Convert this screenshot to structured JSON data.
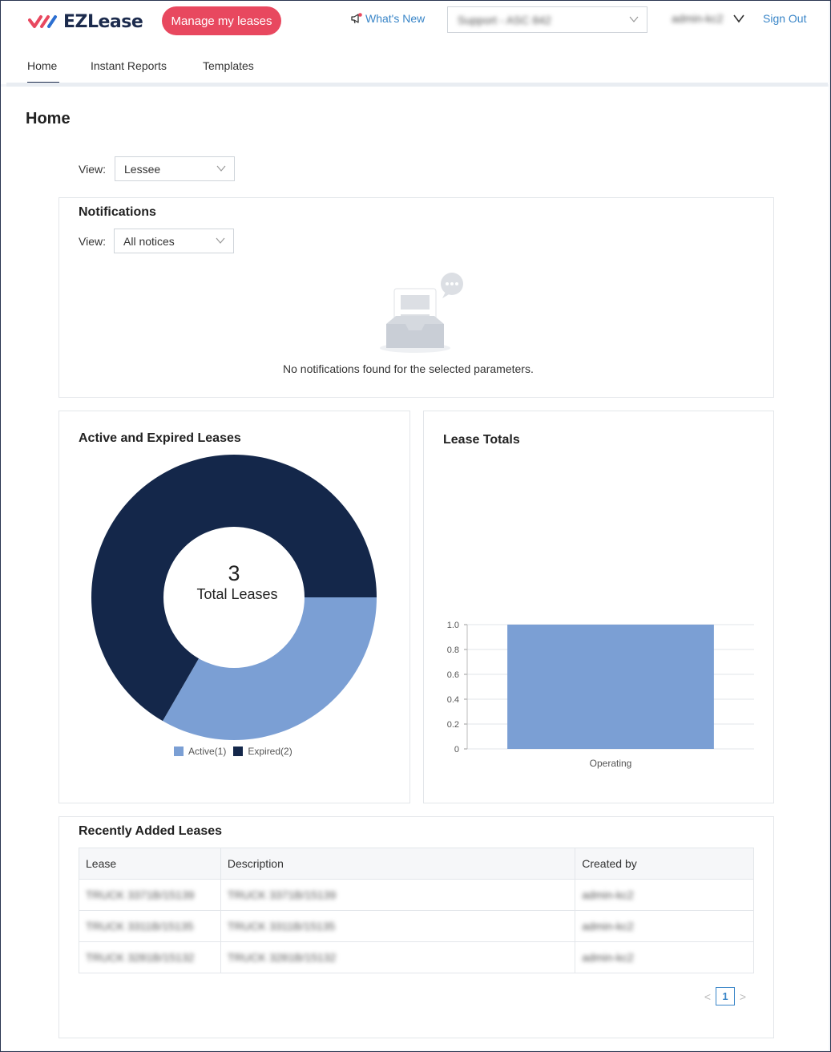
{
  "header": {
    "logo_text": "EZLease",
    "manage_button": "Manage my leases",
    "whats_new": "What's New",
    "support_select_value": "Support - ASC 842",
    "user_name": "admin-kc2",
    "sign_out": "Sign Out"
  },
  "tabs": [
    {
      "label": "Home",
      "active": true
    },
    {
      "label": "Instant Reports"
    },
    {
      "label": "Templates"
    }
  ],
  "page_title": "Home",
  "view_filter": {
    "label": "View:",
    "value": "Lessee"
  },
  "notifications": {
    "title": "Notifications",
    "view_label": "View:",
    "view_value": "All notices",
    "empty_message": "No notifications found for the selected parameters."
  },
  "colors": {
    "accent": "#e8485f",
    "navy": "#14274a",
    "light_blue": "#7b9fd4",
    "link": "#3a86c8"
  },
  "chart_data": [
    {
      "type": "pie",
      "title": "Active and Expired Leases",
      "center_value": "3",
      "center_label": "Total Leases",
      "series": [
        {
          "name": "Active(1)",
          "value": 1,
          "color": "#7b9fd4"
        },
        {
          "name": "Expired(2)",
          "value": 2,
          "color": "#14274a"
        }
      ],
      "legend": "bottom"
    },
    {
      "type": "bar",
      "title": "Lease Totals",
      "categories": [
        "Operating"
      ],
      "values": [
        1.0
      ],
      "ylim": [
        0,
        1.0
      ],
      "yticks": [
        "0",
        "0.2",
        "0.4",
        "0.6",
        "0.8",
        "1.0"
      ],
      "grid": true,
      "color": "#7b9fd4"
    }
  ],
  "recent_leases": {
    "title": "Recently Added Leases",
    "columns": [
      "Lease",
      "Description",
      "Created by"
    ],
    "rows": [
      [
        "TRUCK 3371B/15139",
        "TRUCK 3371B/15139",
        "admin-kc2"
      ],
      [
        "TRUCK 3311B/15135",
        "TRUCK 3311B/15135",
        "admin-kc2"
      ],
      [
        "TRUCK 3281B/15132",
        "TRUCK 3281B/15132",
        "admin-kc2"
      ]
    ],
    "pagination": {
      "current_page": "1",
      "prev": "<",
      "next": ">"
    }
  }
}
